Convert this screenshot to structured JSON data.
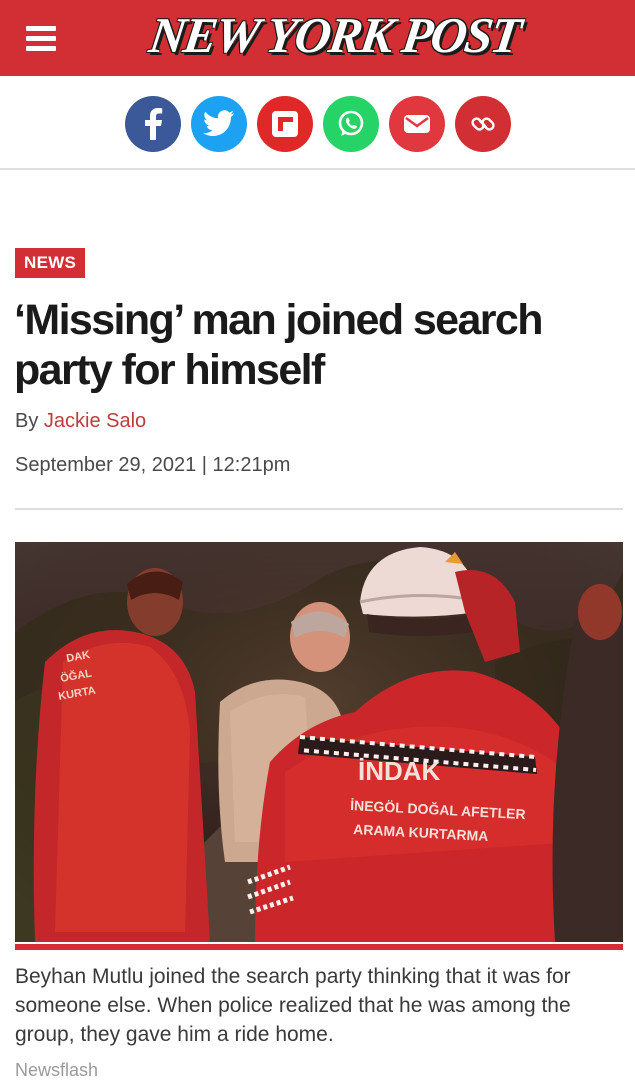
{
  "header": {
    "logo_text": "NEW YORK POST",
    "brand_color": "#d12f33",
    "menu_icon": "hamburger-menu-icon"
  },
  "share": [
    {
      "name": "facebook",
      "icon": "facebook-icon",
      "color": "#3b5998"
    },
    {
      "name": "twitter",
      "icon": "twitter-icon",
      "color": "#1da1f2"
    },
    {
      "name": "flipboard",
      "icon": "flipboard-icon",
      "color": "#e12828"
    },
    {
      "name": "whatsapp",
      "icon": "whatsapp-icon",
      "color": "#25d366"
    },
    {
      "name": "email",
      "icon": "email-icon",
      "color": "#e0383e"
    },
    {
      "name": "copy-link",
      "icon": "link-icon",
      "color": "#d12f33"
    }
  ],
  "article": {
    "section": "NEWS",
    "headline": "‘Missing’ man joined search party for himself",
    "byline_prefix": "By",
    "author": "Jackie Salo",
    "date": "September 29, 2021 | 12:21pm",
    "image": {
      "vest_text_1": "İNDAK",
      "vest_text_2": "İNEGÖL DOĞAL AFETLER",
      "vest_text_3": "ARAMA KURTARMA"
    },
    "caption": "Beyhan Mutlu joined the search party thinking that it was for someone else. When police realized that he was among the group, they gave him a ride home.",
    "credit": "Newsflash"
  }
}
